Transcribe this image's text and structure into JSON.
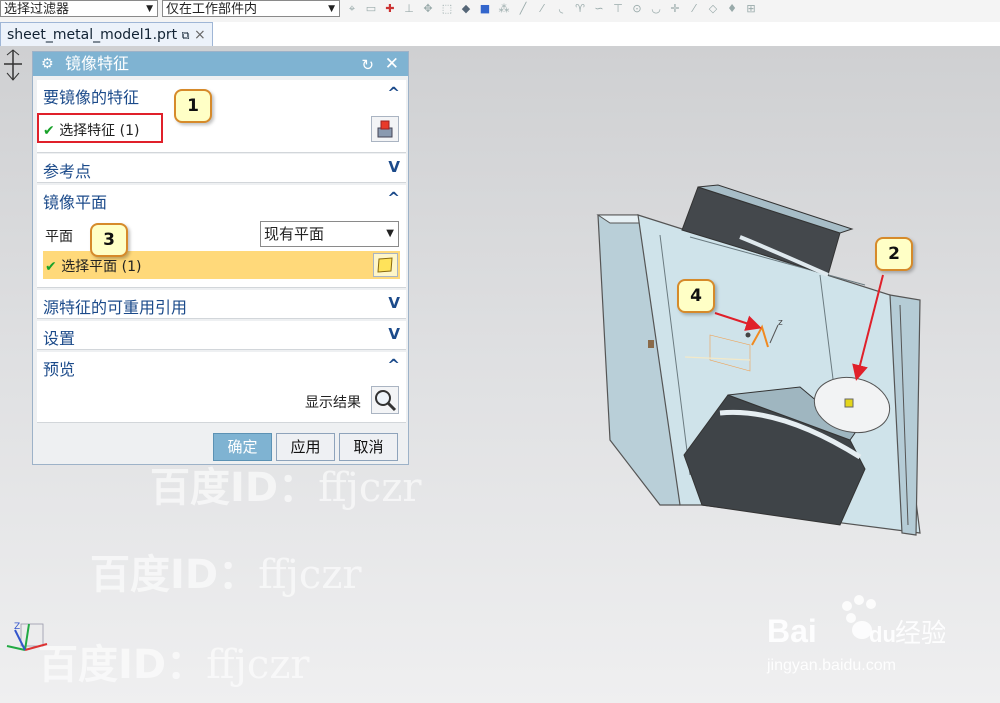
{
  "toolbar": {
    "filter_select": "选择过滤器",
    "scope_select": "仅在工作部件内"
  },
  "tab": {
    "label": "sheet_metal_model1.prt",
    "close": "×"
  },
  "dialog": {
    "title": "镜像特征",
    "sections": {
      "features": {
        "title": "要镜像的特征",
        "select_label": "选择特征 (1)"
      },
      "ref_point": {
        "title": "参考点"
      },
      "mirror_plane": {
        "title": "镜像平面",
        "plane_label": "平面",
        "plane_value": "现有平面",
        "select_label": "选择平面 (1)"
      },
      "reusable": {
        "title": "源特征的可重用引用"
      },
      "settings": {
        "title": "设置"
      },
      "preview": {
        "title": "预览",
        "show_result": "显示结果"
      }
    },
    "buttons": {
      "ok": "确定",
      "apply": "应用",
      "cancel": "取消"
    }
  },
  "callouts": [
    "1",
    "2",
    "3",
    "4"
  ],
  "watermark": {
    "prefix": "百度ID：",
    "id": "ffjczr"
  },
  "logo": {
    "brand": "Bai",
    "du": "du",
    "jingyan": "经验",
    "url": "jingyan.baidu.com"
  },
  "colors": {
    "dialog_title": "#7fb3d2",
    "ok_button": "#7fb3d2",
    "highlight_row": "#ffd97a",
    "callout_border": "#d68a2a",
    "red_frame": "#e0202a"
  }
}
